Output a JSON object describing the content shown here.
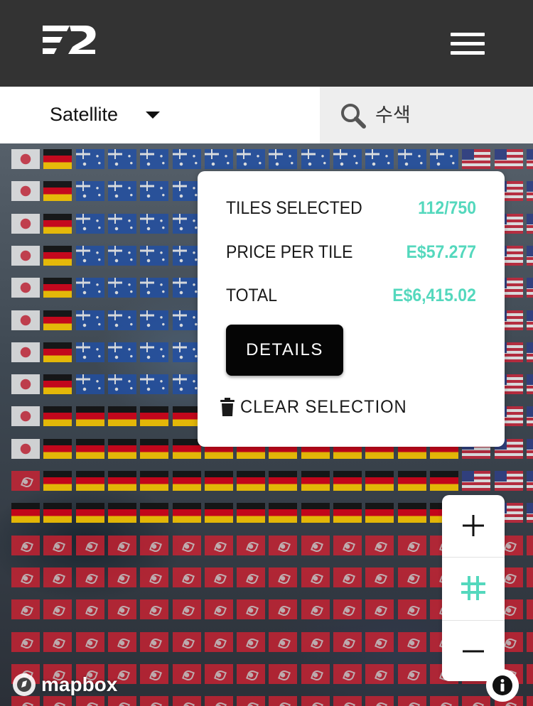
{
  "header": {
    "logo_icon": "e2-logo",
    "menu_icon": "hamburger-menu-icon"
  },
  "toolbar": {
    "layer_label": "Satellite",
    "search_placeholder": "수색",
    "search_icon": "search-icon"
  },
  "selection_card": {
    "tiles_selected_label": "TILES SELECTED",
    "tiles_selected_value": "112/750",
    "price_per_tile_label": "PRICE PER TILE",
    "price_per_tile_value": "E$57.277",
    "total_label": "TOTAL",
    "total_value": "E$6,415.02",
    "details_button": "DETAILS",
    "clear_selection": "CLEAR SELECTION",
    "accent_color": "#54d8bd"
  },
  "map_controls": {
    "zoom_in_icon": "plus-icon",
    "grid_icon": "grid-hash-icon",
    "zoom_out_icon": "minus-icon",
    "grid_color": "#54d8bd"
  },
  "attribution": {
    "mapbox": "mapbox",
    "info_icon": "info-icon"
  },
  "tile_flags": [
    "japan",
    "germany",
    "australia",
    "united-states",
    "isle-of-man"
  ]
}
